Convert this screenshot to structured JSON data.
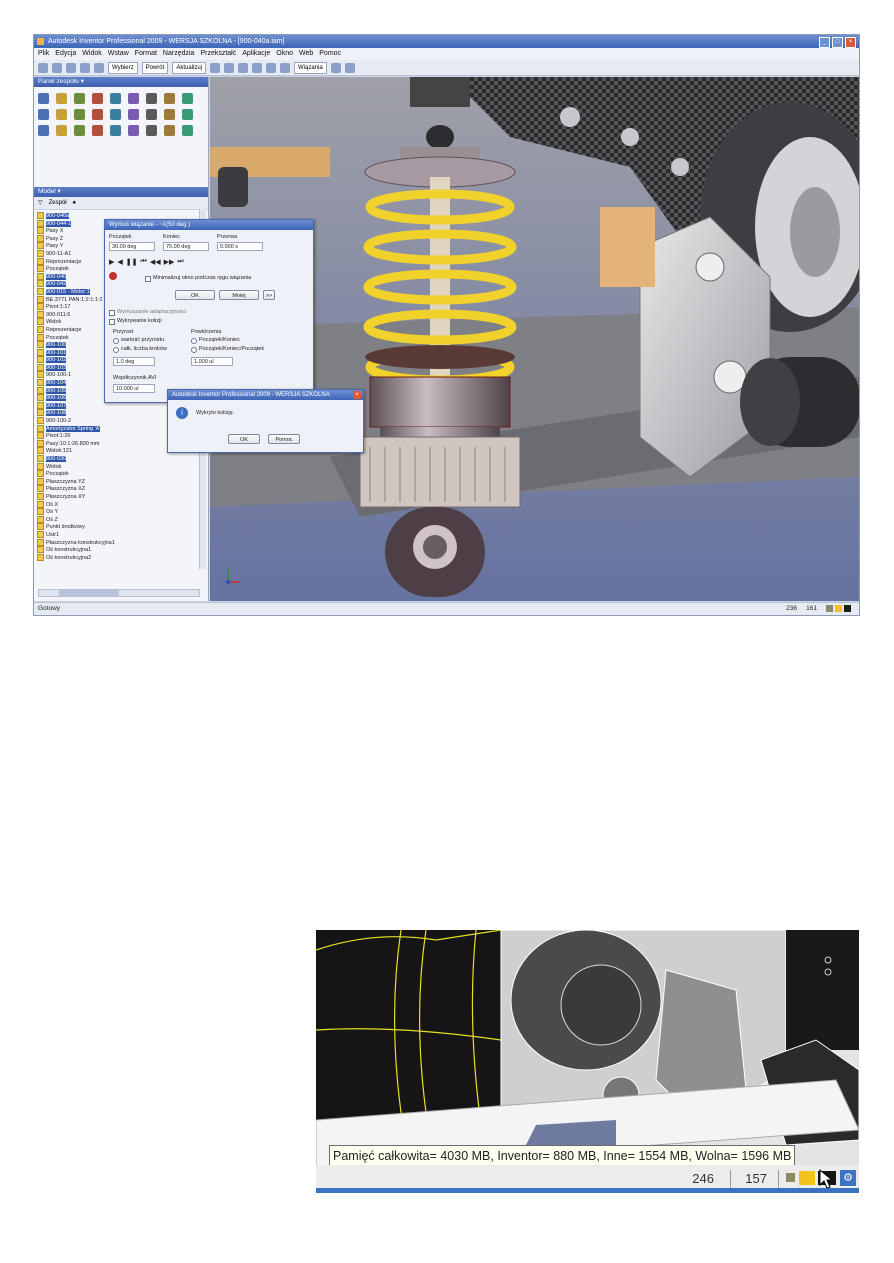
{
  "window": {
    "title": "Autodesk Inventor Professional 2009 - WERSJA SZKOLNA - [900-040a.iam]"
  },
  "menu": [
    "Plik",
    "Edycja",
    "Widok",
    "Wstaw",
    "Format",
    "Narzędzia",
    "Przekształć",
    "Aplikacje",
    "Okno",
    "Web",
    "Pomoc"
  ],
  "toolbar": {
    "style_select": "Wiązania",
    "return_label": "Powrót",
    "update_label": "Aktualizuj",
    "select_label": "Wybierz"
  },
  "panels": {
    "tools_title": "Panel zespołu ▾",
    "model_title": "Model ▾",
    "model_filter": "Zespół"
  },
  "tree": [
    {
      "label": "900-040a",
      "sel": true
    },
    {
      "label": "900-044-1",
      "sel": true
    },
    {
      "label": "Pasy X",
      "sel": false
    },
    {
      "label": "Pasy Z",
      "sel": false
    },
    {
      "label": "Pasy Y",
      "sel": false
    },
    {
      "label": "900-11-A1",
      "sel": false
    },
    {
      "label": "Reprezentacje",
      "sel": false
    },
    {
      "label": "Początek",
      "sel": false
    },
    {
      "label": "900-040",
      "sel": true
    },
    {
      "label": "900-042",
      "sel": true
    },
    {
      "label": "900-015 - Motor:1",
      "sel": true
    },
    {
      "label": "BE:3771 PAN:1:2:1:1:2",
      "sel": false
    },
    {
      "label": "Pivot:1:17",
      "sel": false
    },
    {
      "label": "900-011:6",
      "sel": false
    },
    {
      "label": "Widok",
      "sel": false
    },
    {
      "label": "Reprezentacje",
      "sel": false
    },
    {
      "label": "Początek",
      "sel": false
    },
    {
      "label": "900-100",
      "sel": true
    },
    {
      "label": "900-101",
      "sel": true
    },
    {
      "label": "900-102",
      "sel": true
    },
    {
      "label": "900-103",
      "sel": true
    },
    {
      "label": "900-100-1",
      "sel": false
    },
    {
      "label": "900-104",
      "sel": true
    },
    {
      "label": "900-105",
      "sel": true
    },
    {
      "label": "900-106",
      "sel": true
    },
    {
      "label": "900-107",
      "sel": true
    },
    {
      "label": "900-108",
      "sel": true
    },
    {
      "label": "900-100-2",
      "sel": false
    },
    {
      "label": "Amortyzator Spring 'A'",
      "sel": true
    },
    {
      "label": "Pivot:1:26",
      "sel": false
    },
    {
      "label": "Pasy:10:1:26.800 mm",
      "sel": false
    },
    {
      "label": "Widok:121",
      "sel": false
    },
    {
      "label": "900-030",
      "sel": true
    },
    {
      "label": "Widok",
      "sel": false
    },
    {
      "label": "Początek",
      "sel": false
    },
    {
      "label": "Płaszczyzna YZ",
      "sel": false
    },
    {
      "label": "Płaszczyzna XZ",
      "sel": false
    },
    {
      "label": "Płaszczyzna XY",
      "sel": false
    },
    {
      "label": "Oś X",
      "sel": false
    },
    {
      "label": "Oś Y",
      "sel": false
    },
    {
      "label": "Oś Z",
      "sel": false
    },
    {
      "label": "Punkt środkowy",
      "sel": false
    },
    {
      "label": "Ustr1",
      "sel": false
    },
    {
      "label": "Płaszczyzna konstrukcyjna1",
      "sel": false
    },
    {
      "label": "Oś konstrukcyjna1",
      "sel": false
    },
    {
      "label": "Oś konstrukcyjna2",
      "sel": false
    }
  ],
  "drive_dialog": {
    "title": "Wymuś wiązanie - ~1(50 deg )",
    "start_label": "Początek",
    "start_value": "30.00 deg",
    "end_label": "Koniec",
    "end_value": "70.00 deg",
    "pause_label": "Przerwa",
    "pause_value": "0.000 s",
    "minimize_label": "Minimalizuj okno podczas ręgu wiązania",
    "ok": "OK",
    "more": "Mniej",
    "more_arrow": ">>",
    "drive_adaptivity": "Wymuszanie adaptacyjności",
    "collision": "Wykrywanie kolizji",
    "increment_label": "Przyrost",
    "increment_amount": "wartość przyrostu",
    "total_steps": "całk. liczba kroków",
    "increment_value": "1.0 deg",
    "repetitions_label": "Powtórzenia",
    "start_end": "Początek/Koniec",
    "start_end_start": "Początek/Koniec/Początek",
    "repetitions_value": "1.000 ul",
    "avi_rate_label": "Współczynnik AVI",
    "avi_rate_value": "10.000 ul"
  },
  "msg_dialog": {
    "title": "Autodesk Inventor Professional 2009 - WERSJA SZKOLNA",
    "text": "Wykryto kolizję.",
    "ok": "OK",
    "help": "Pomoc"
  },
  "statusbar": {
    "left": "Gotowy",
    "n1": "236",
    "n2": "161"
  },
  "tooltip": {
    "text": "Pamięć całkowita= 4030 MB, Inventor= 880 MB, Inne= 1554 MB, Wolna= 1596 MB"
  },
  "status2": {
    "n1": "246",
    "n2": "157"
  }
}
